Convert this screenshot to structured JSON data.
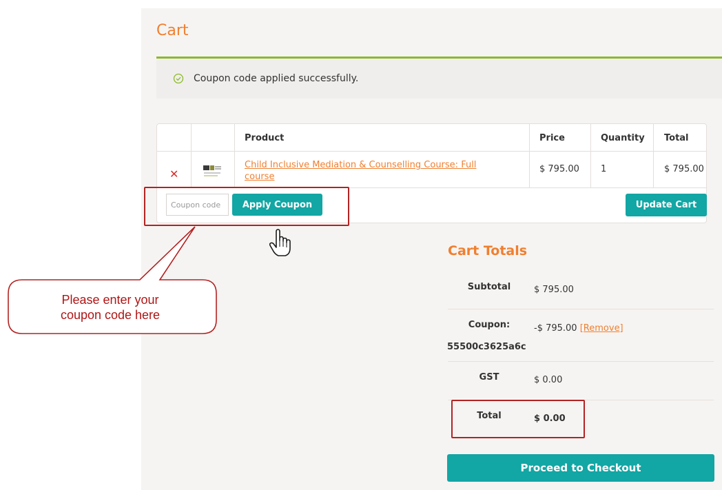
{
  "page": {
    "title": "Cart"
  },
  "notice": {
    "text": "Coupon code applied successfully.",
    "icon": "check-circle-icon",
    "color": "#8cb82b"
  },
  "cart_table": {
    "headers": {
      "product": "Product",
      "price": "Price",
      "quantity": "Quantity",
      "total": "Total"
    },
    "rows": [
      {
        "product": "Child Inclusive Mediation & Counselling Course: Full course",
        "price": "$ 795.00",
        "quantity": "1",
        "total": "$ 795.00"
      }
    ]
  },
  "coupon": {
    "placeholder": "Coupon code",
    "apply_label": "Apply Coupon"
  },
  "update_label": "Update Cart",
  "cart_totals": {
    "title": "Cart Totals",
    "subtotal_label": "Subtotal",
    "subtotal_value": "$ 795.00",
    "coupon_label": "Coupon:",
    "coupon_code": "55500c3625a6c",
    "coupon_value": "-$ 795.00",
    "remove_label": "[Remove]",
    "gst_label": "GST",
    "gst_value": "$ 0.00",
    "total_label": "Total",
    "total_value": "$ 0.00"
  },
  "checkout_label": "Proceed to Checkout",
  "annotation": {
    "line1": "Please enter your",
    "line2": "coupon code here"
  },
  "colors": {
    "accent_orange": "#f07f2f",
    "teal": "#12a6a4",
    "green_rule": "#8cb82b",
    "annotation_red": "#b22222"
  }
}
